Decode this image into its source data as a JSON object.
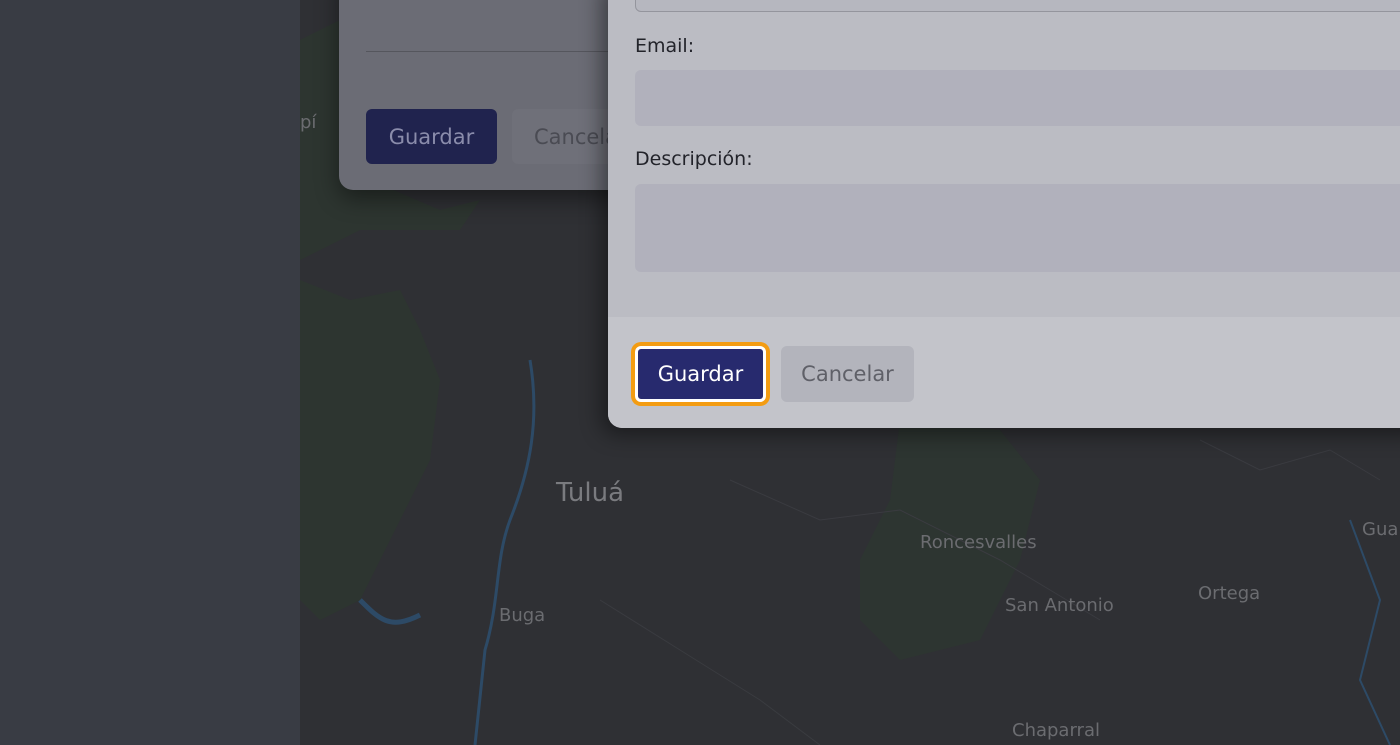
{
  "background_dialog": {
    "save_label": "Guardar",
    "cancel_label": "Cancela"
  },
  "dialog": {
    "email_label": "Email:",
    "email_value": "",
    "description_label": "Descripción:",
    "description_value": "",
    "save_label": "Guardar",
    "cancel_label": "Cancelar"
  },
  "map": {
    "labels": [
      "pí",
      "Tuluá",
      "Roncesvalles",
      "San Antonio",
      "Ortega",
      "Buga",
      "Gua",
      "Chaparral"
    ]
  },
  "colors": {
    "primary_button": "#272a6e",
    "focus_ring": "#f39c12"
  }
}
